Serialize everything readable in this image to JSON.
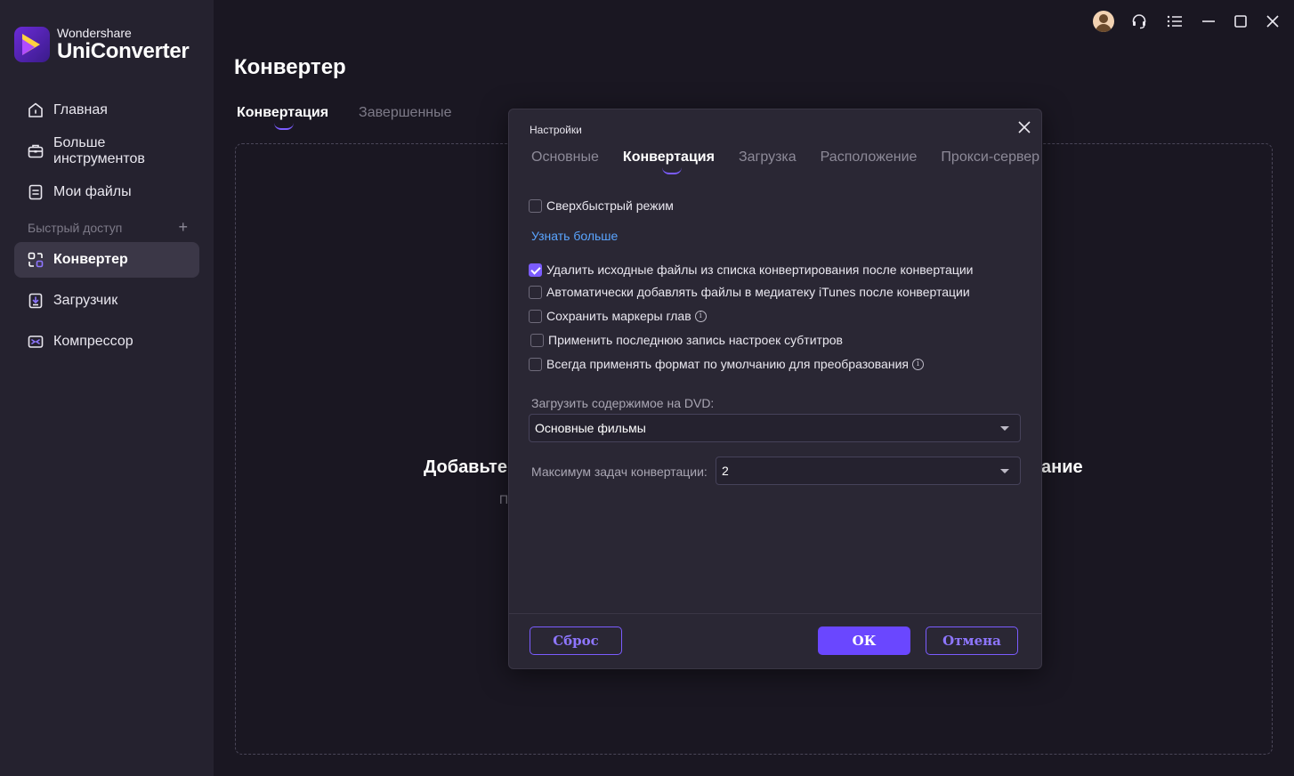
{
  "app": {
    "brand_small": "Wondershare",
    "brand_big": "UniConverter"
  },
  "sidebar": {
    "items": [
      {
        "label": "Главная",
        "icon": "home-icon"
      },
      {
        "label": "Больше инструментов",
        "icon": "toolbox-icon"
      },
      {
        "label": "Мои файлы",
        "icon": "files-icon"
      }
    ],
    "quick_access_label": "Быстрый доступ",
    "quick_items": [
      {
        "label": "Конвертер",
        "icon": "converter-icon",
        "active": true
      },
      {
        "label": "Загрузчик",
        "icon": "downloader-icon"
      },
      {
        "label": "Компрессор",
        "icon": "compressor-icon"
      }
    ]
  },
  "main": {
    "title": "Конвертер",
    "tabs": [
      {
        "label": "Конвертация",
        "active": true
      },
      {
        "label": "Завершенные"
      }
    ],
    "drop_title_left": "Добавьте",
    "drop_title_right": "ание",
    "drop_sub": "П"
  },
  "settings": {
    "title": "Настройки",
    "tabs": [
      {
        "label": "Основные"
      },
      {
        "label": "Конвертация",
        "active": true
      },
      {
        "label": "Загрузка"
      },
      {
        "label": "Расположение"
      },
      {
        "label": "Прокси-сервер"
      }
    ],
    "options": {
      "ultrafast": {
        "label": "Сверхбыстрый режим",
        "checked": false
      },
      "learn_more": "Узнать больше",
      "delete_sources": {
        "label": "Удалить исходные файлы из списка конвертирования после конвертации",
        "checked": true
      },
      "add_itunes": {
        "label": "Автоматически добавлять файлы в медиатеку iTunes после конвертации",
        "checked": false
      },
      "save_chapters": {
        "label": "Сохранить маркеры глав",
        "checked": false
      },
      "apply_subtitles": {
        "label": "Применить последнюю запись настроек субтитров",
        "checked": false
      },
      "default_format": {
        "label": "Всегда применять формат по умолчанию для преобразования",
        "checked": false
      }
    },
    "dvd_label": "Загрузить содержимое на DVD:",
    "dvd_value": "Основные фильмы",
    "max_tasks_label": "Максимум задач конвертации:",
    "max_tasks_value": "2",
    "buttons": {
      "reset": "Сброс",
      "ok": "ОК",
      "cancel": "Отмена"
    }
  },
  "colors": {
    "accent": "#7b5cff",
    "link": "#5aa5ff",
    "background": "#1a1722",
    "sidebar": "#25222f"
  }
}
